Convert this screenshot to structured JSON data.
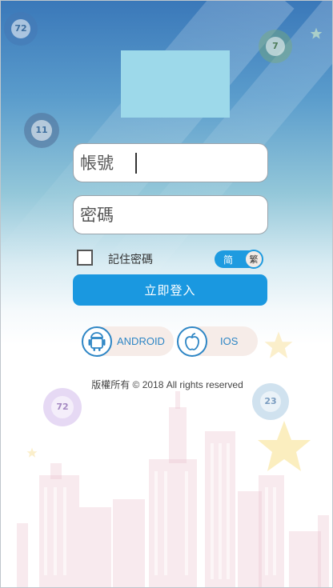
{
  "login_form": {
    "username_placeholder": "帳號",
    "password_placeholder": "密碼",
    "remember_label": "記住密碼",
    "language_toggle": {
      "left_label": "简",
      "knob_label": "繁"
    },
    "login_button": "立即登入"
  },
  "downloads": {
    "android_label": "ANDROID",
    "ios_label": "IOS"
  },
  "decor": {
    "ball_numbers": [
      "72",
      "11",
      "7",
      "72",
      "23"
    ]
  },
  "footer": {
    "copyright": "版權所有 © 2018 All rights reserved"
  },
  "colors": {
    "accent": "#1a98e0",
    "logo_placeholder": "#9dd9ea",
    "header_blue": "#3a78b9"
  }
}
